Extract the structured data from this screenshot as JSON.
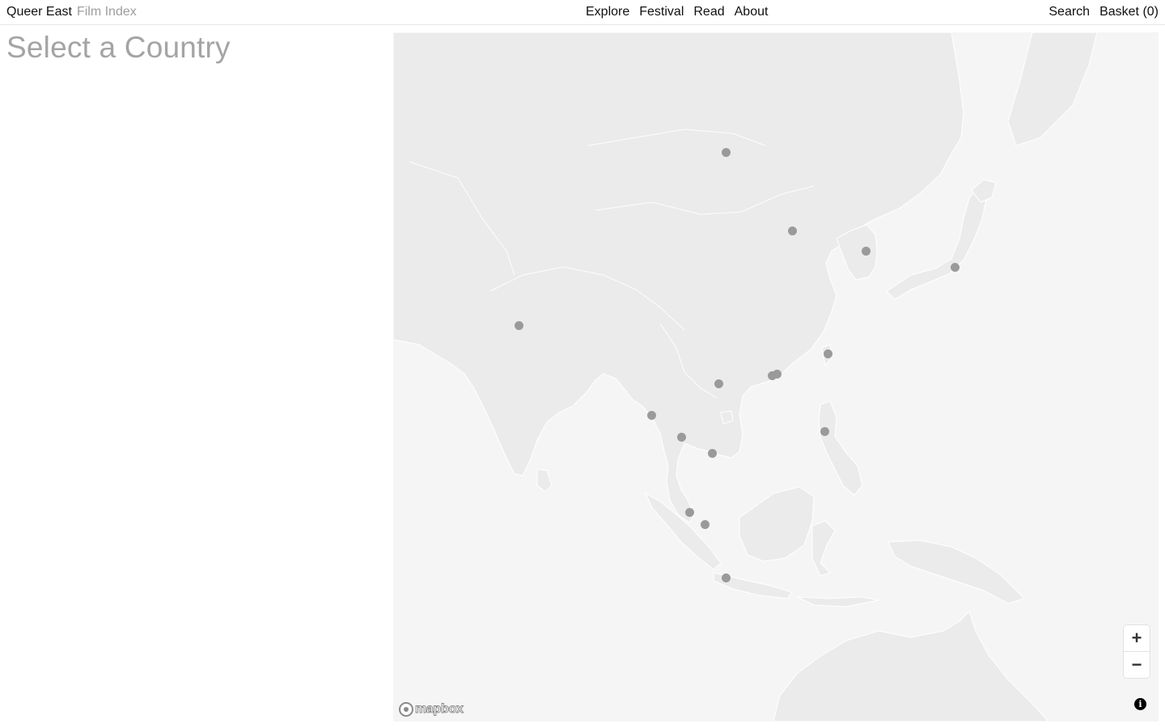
{
  "header": {
    "brand_name": "Queer East",
    "brand_sub": "Film Index",
    "nav": [
      "Explore",
      "Festival",
      "Read",
      "About"
    ],
    "search": "Search",
    "basket": "Basket (0)"
  },
  "main": {
    "title": "Select a Country"
  },
  "map": {
    "land_color": "#ebebeb",
    "water_color": "#f5f5f5",
    "marker_color": "#9a9a9a",
    "zoom_in": "+",
    "zoom_out": "−",
    "logo": "mapbox",
    "info": "i",
    "markers": [
      "mongolia",
      "china",
      "south-korea",
      "japan",
      "india",
      "taiwan",
      "hong-kong",
      "macau",
      "vietnam",
      "myanmar",
      "thailand",
      "cambodia",
      "philippines",
      "malaysia",
      "singapore",
      "indonesia"
    ]
  }
}
